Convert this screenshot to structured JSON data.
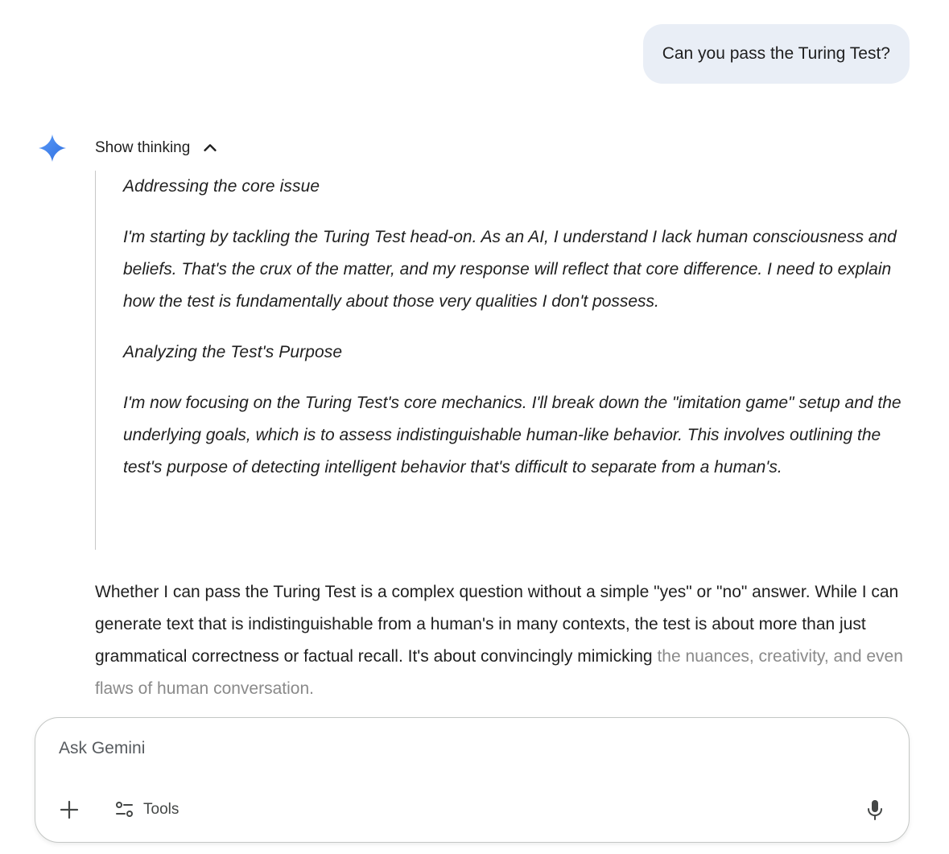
{
  "user_message": "Can you pass the Turing Test?",
  "thinking": {
    "toggle_label": "Show thinking",
    "sections": [
      {
        "heading": "Addressing the core issue",
        "body": "I'm starting by tackling the Turing Test head-on. As an AI, I understand I lack human consciousness and beliefs. That's the crux of the matter, and my response will reflect that core difference. I need to explain how the test is fundamentally about those very qualities I don't possess."
      },
      {
        "heading": "Analyzing the Test's Purpose",
        "body": "I'm now focusing on the Turing Test's core mechanics. I'll break down the \"imitation game\" setup and the underlying goals, which is to assess indistinguishable human-like behavior. This involves outlining the test's purpose of detecting intelligent behavior that's difficult to separate from a human's."
      }
    ]
  },
  "answer": {
    "text": "Whether I can pass the Turing Test is a complex question without a simple \"yes\" or \"no\" answer. While I can generate text that is indistinguishable from a human's in many contexts, the test is about more than just grammatical correctness or factual recall. It's about convincingly mimicking",
    "faded_text": "the nuances, creativity, and even flaws of human conversation."
  },
  "input": {
    "placeholder": "Ask Gemini",
    "tools_label": "Tools"
  },
  "icons": {
    "spark": "gemini-spark-icon",
    "toggle": "chevron-up-icon",
    "add": "plus-icon",
    "tools": "tools-sliders-icon",
    "mic": "microphone-icon"
  },
  "colors": {
    "user_bubble": "#e9eef6",
    "spark_start": "#4f8ef7",
    "spark_end": "#2f6fe0",
    "faded_text": "#8a8a8a"
  }
}
